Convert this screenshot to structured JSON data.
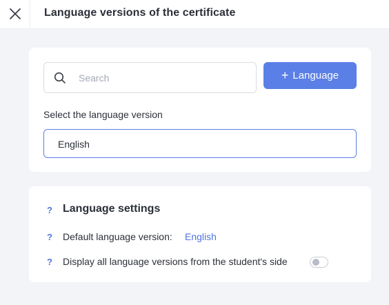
{
  "header": {
    "close_icon": "close-icon",
    "title": "Language versions of the certificate"
  },
  "search": {
    "placeholder": "Search",
    "icon": "search-icon"
  },
  "add_language_button": {
    "plus": "+",
    "label": "Language",
    "color": "#5a7fe6"
  },
  "language_select": {
    "label": "Select the language version",
    "value": "English"
  },
  "settings": {
    "help_mark": "?",
    "title": "Language settings",
    "default_language_label": "Default language version:",
    "default_language_value": "English",
    "display_all_label": "Display all language versions from the student's side",
    "display_all_enabled": false
  },
  "colors": {
    "accent": "#5a7fe6",
    "link": "#4f76e0",
    "background": "#f3f4f7"
  }
}
